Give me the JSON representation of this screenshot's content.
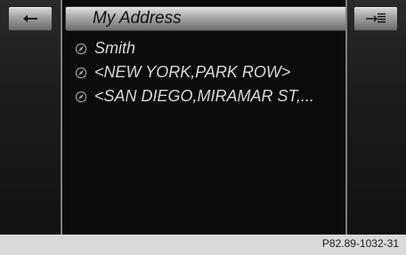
{
  "header": {
    "title": "My Address"
  },
  "toolbar": {
    "back_icon": "back-arrow-icon",
    "options_icon": "options-menu-icon"
  },
  "list": {
    "items": [
      {
        "label": "Smith",
        "icon": "compass-icon"
      },
      {
        "label": "<NEW YORK,PARK ROW>",
        "icon": "compass-icon"
      },
      {
        "label": "<SAN DIEGO,MIRAMAR ST,...",
        "icon": "compass-icon"
      }
    ]
  },
  "footer": {
    "reference": "P82.89-1032-31"
  }
}
